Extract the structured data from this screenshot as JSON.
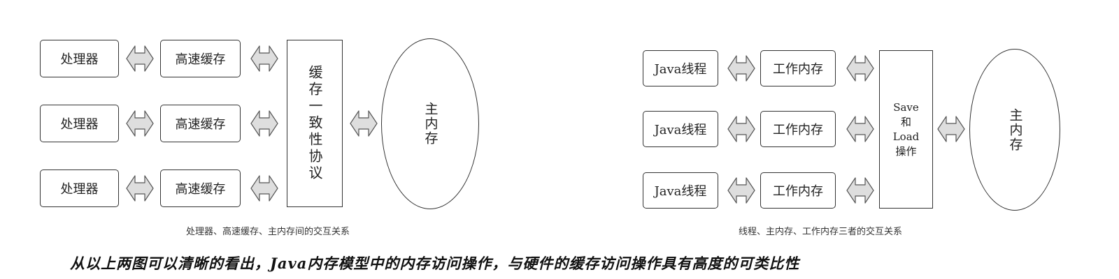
{
  "left_diagram": {
    "processor_label": "处理器",
    "cache_label": "高速缓存",
    "protocol_label": "缓存一致性协议",
    "memory_label": "主内存",
    "caption": "处理器、高速缓存、主内存间的交互关系"
  },
  "right_diagram": {
    "thread_label": "Java线程",
    "work_memory_label": "工作内存",
    "save_load": {
      "line1": "Save",
      "line2": "和",
      "line3": "Load",
      "line4": "操作"
    },
    "memory_label": "主内存",
    "caption": "线程、主内存、工作内存三者的交互关系"
  },
  "bottom_text": "从以上两图可以清晰的看出，Java内存模型中的内存访问操作，与硬件的缓存访问操作具有高度的可类比性",
  "colors": {
    "arrow_fill": "#dedede",
    "border": "#333333"
  }
}
